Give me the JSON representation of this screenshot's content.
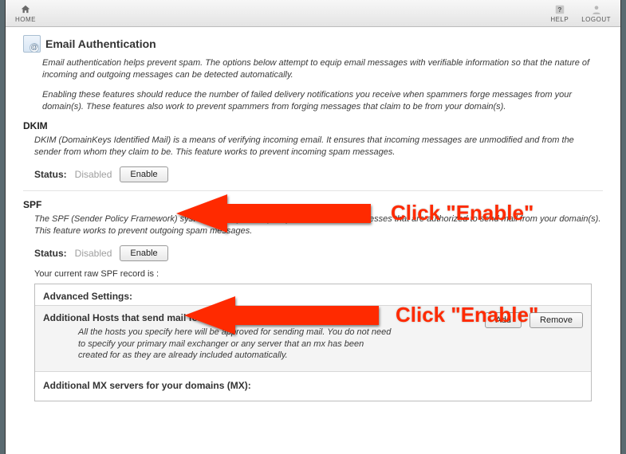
{
  "nav": {
    "home": "HOME",
    "help": "HELP",
    "logout": "LOGOUT"
  },
  "page": {
    "title": "Email Authentication",
    "intro1": "Email authentication helps prevent spam. The options below attempt to equip email messages with verifiable information so that the nature of incoming and outgoing messages can be detected automatically.",
    "intro2": "Enabling these features should reduce the number of failed delivery notifications you receive when spammers forge messages from your domain(s). These features also work to prevent spammers from forging messages that claim to be from your domain(s)."
  },
  "dkim": {
    "heading": "DKIM",
    "desc": "DKIM (DomainKeys Identified Mail) is a means of verifying incoming email. It ensures that incoming messages are unmodified and from the sender from whom they claim to be. This feature works to prevent incoming spam messages.",
    "status_label": "Status:",
    "status_value": "Disabled",
    "enable_btn": "Enable"
  },
  "spf": {
    "heading": "SPF",
    "desc": "The SPF (Sender Policy Framework) system allows you to specify servers and IP addresses that are authorized to send mail from your domain(s). This feature works to prevent outgoing spam messages.",
    "status_label": "Status:",
    "status_value": "Disabled",
    "enable_btn": "Enable",
    "raw_note": "Your current raw SPF record is :"
  },
  "advanced": {
    "heading": "Advanced Settings:",
    "hosts_title": "Additional Hosts that send mail for your domains (A):",
    "hosts_desc": "All the hosts you specify here will be approved for sending mail. You do not need to specify your primary mail exchanger or any server that an mx has been created for as they are already included automatically.",
    "add_btn": "Add",
    "remove_btn": "Remove",
    "mx_title": "Additional MX servers for your domains (MX):"
  },
  "annotations": {
    "click_enable": "Click \"Enable\""
  }
}
